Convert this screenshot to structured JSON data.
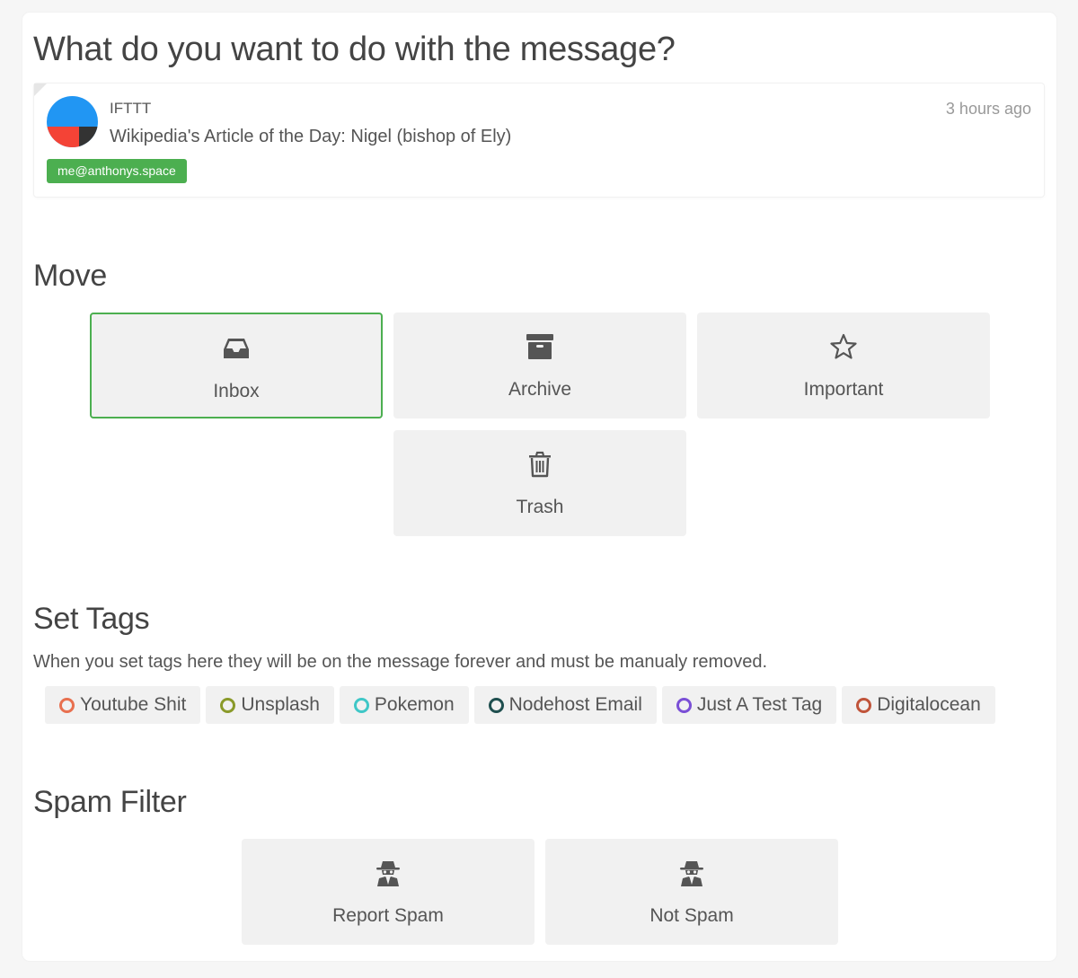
{
  "page_title": "What do you want to do with the message?",
  "message": {
    "sender": "IFTTT",
    "subject": "Wikipedia's Article of the Day: Nigel (bishop of Ely)",
    "time": "3 hours ago",
    "account": "me@anthonys.space",
    "avatar_icon": "ifttt-logo-icon"
  },
  "move": {
    "title": "Move",
    "actions": [
      {
        "label": "Inbox",
        "icon": "inbox-icon",
        "selected": true
      },
      {
        "label": "Archive",
        "icon": "archive-icon",
        "selected": false
      },
      {
        "label": "Important",
        "icon": "star-icon",
        "selected": false
      },
      {
        "label": "Trash",
        "icon": "trash-icon",
        "selected": false
      }
    ]
  },
  "tags": {
    "title": "Set Tags",
    "description": "When you set tags here they will be on the message forever and must be manualy removed.",
    "items": [
      {
        "label": "Youtube Shit",
        "color": "#e8704f"
      },
      {
        "label": "Unsplash",
        "color": "#8a9a2a"
      },
      {
        "label": "Pokemon",
        "color": "#3fc7c7"
      },
      {
        "label": "Nodehost Email",
        "color": "#1f4f4f"
      },
      {
        "label": "Just A Test Tag",
        "color": "#7a4fd6"
      },
      {
        "label": "Digitalocean",
        "color": "#c0543a"
      }
    ]
  },
  "spam": {
    "title": "Spam Filter",
    "actions": [
      {
        "label": "Report Spam",
        "icon": "spy-icon"
      },
      {
        "label": "Not Spam",
        "icon": "spy-icon"
      }
    ]
  },
  "colors": {
    "accent_green": "#4caf50",
    "tile_bg": "#f1f1f1",
    "avatar_blue": "#2196f3",
    "avatar_red": "#f44336",
    "avatar_dark": "#333333"
  }
}
